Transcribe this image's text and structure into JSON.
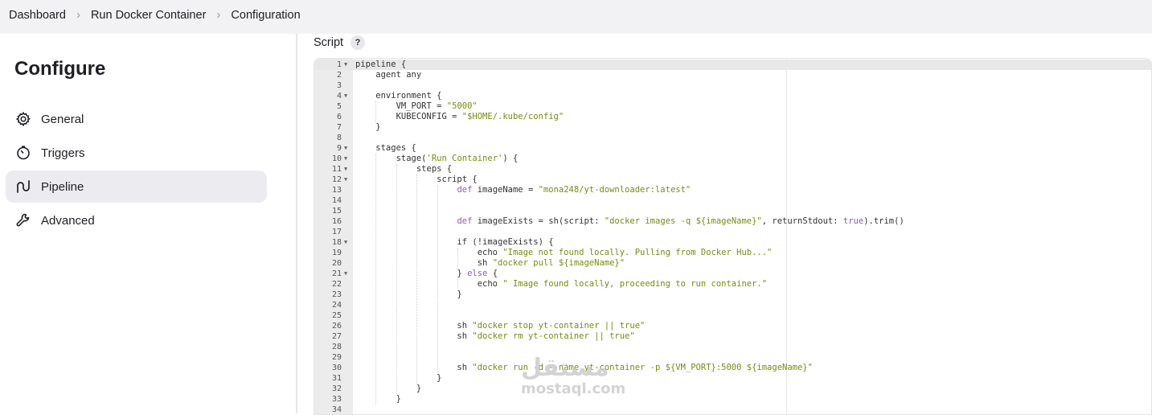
{
  "breadcrumb": [
    "Dashboard",
    "Run Docker Container",
    "Configuration"
  ],
  "sidebar": {
    "title": "Configure",
    "items": [
      {
        "label": "General",
        "icon": "gear-icon"
      },
      {
        "label": "Triggers",
        "icon": "stopwatch-icon"
      },
      {
        "label": "Pipeline",
        "icon": "pipeline-icon",
        "active": true
      },
      {
        "label": "Advanced",
        "icon": "wrench-icon"
      }
    ]
  },
  "script": {
    "label": "Script",
    "help": "?",
    "lines": [
      "pipeline {",
      "    agent any",
      "",
      "    environment {",
      "        VM_PORT = \"5000\"",
      "        KUBECONFIG = \"$HOME/.kube/config\"",
      "    }",
      "",
      "    stages {",
      "        stage('Run Container') {",
      "            steps {",
      "                script {",
      "                    def imageName = \"mona248/yt-downloader:latest\"",
      "",
      "",
      "                    def imageExists = sh(script: \"docker images -q ${imageName}\", returnStdout: true).trim()",
      "",
      "                    if (!imageExists) {",
      "                        echo \"Image not found locally. Pulling from Docker Hub...\"",
      "                        sh \"docker pull ${imageName}\"",
      "                    } else {",
      "                        echo \" Image found locally, proceeding to run container.\"",
      "                    }",
      "",
      "",
      "                    sh \"docker stop yt-container || true\"",
      "                    sh \"docker rm yt-container || true\"",
      "",
      "",
      "                    sh \"docker run -d --name yt-container -p ${VM_PORT}:5000 ${imageName}\"",
      "                }",
      "            }",
      "        }",
      ""
    ],
    "fold_lines": [
      1,
      4,
      9,
      10,
      11,
      12,
      18,
      21
    ]
  },
  "watermark": {
    "arabic": "مستقل",
    "latin": "mostaql.com"
  },
  "colors": {
    "keyword": "#8a5fae",
    "string": "#7a8a12",
    "active_nav": "#ececf0"
  }
}
